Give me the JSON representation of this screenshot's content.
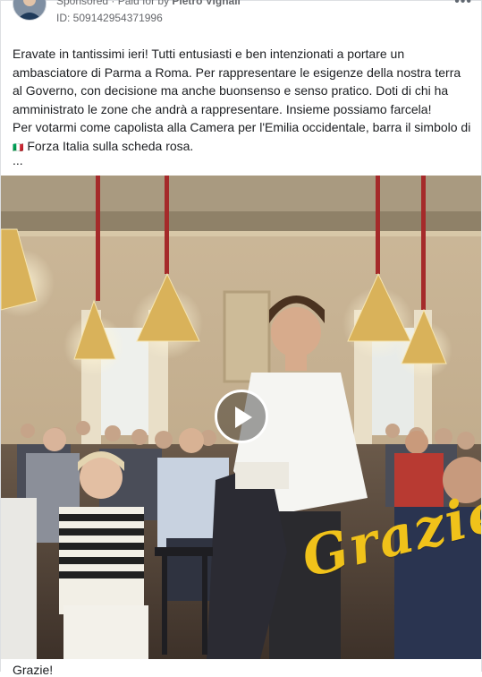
{
  "post": {
    "sponsored_label": "Sponsored",
    "paid_for_prefix": "· Paid for by ",
    "payer": "Pietro Vignali",
    "ad_id": "ID: 509142954371996",
    "more_label": "•••",
    "paragraphs": [
      "Eravate in tantissimi ieri! Tutti entusiasti e ben intenzionati a portare un ambasciatore di Parma a Roma. Per rappresentare le esigenze della nostra terra al Governo, con decisione ma anche buonsenso e senso pratico. Doti di chi ha amministrato le zone che andrà a rappresentare. Insieme possiamo farcela!",
      "Per votarmi come capolista alla Camera per l'Emilia occidentale, barra il simbolo di ",
      "Forza Italia sulla scheda rosa."
    ],
    "flag_glyph": "🇮🇹",
    "ellipsis": "...",
    "media_overlay_text": "Grazie!",
    "caption": "Grazie!"
  },
  "icons": {
    "play": "play-icon",
    "avatar": "avatar"
  },
  "colors": {
    "overlay_text": "#f0c21a",
    "muted_text": "#65676b",
    "border": "#dddfe2"
  }
}
